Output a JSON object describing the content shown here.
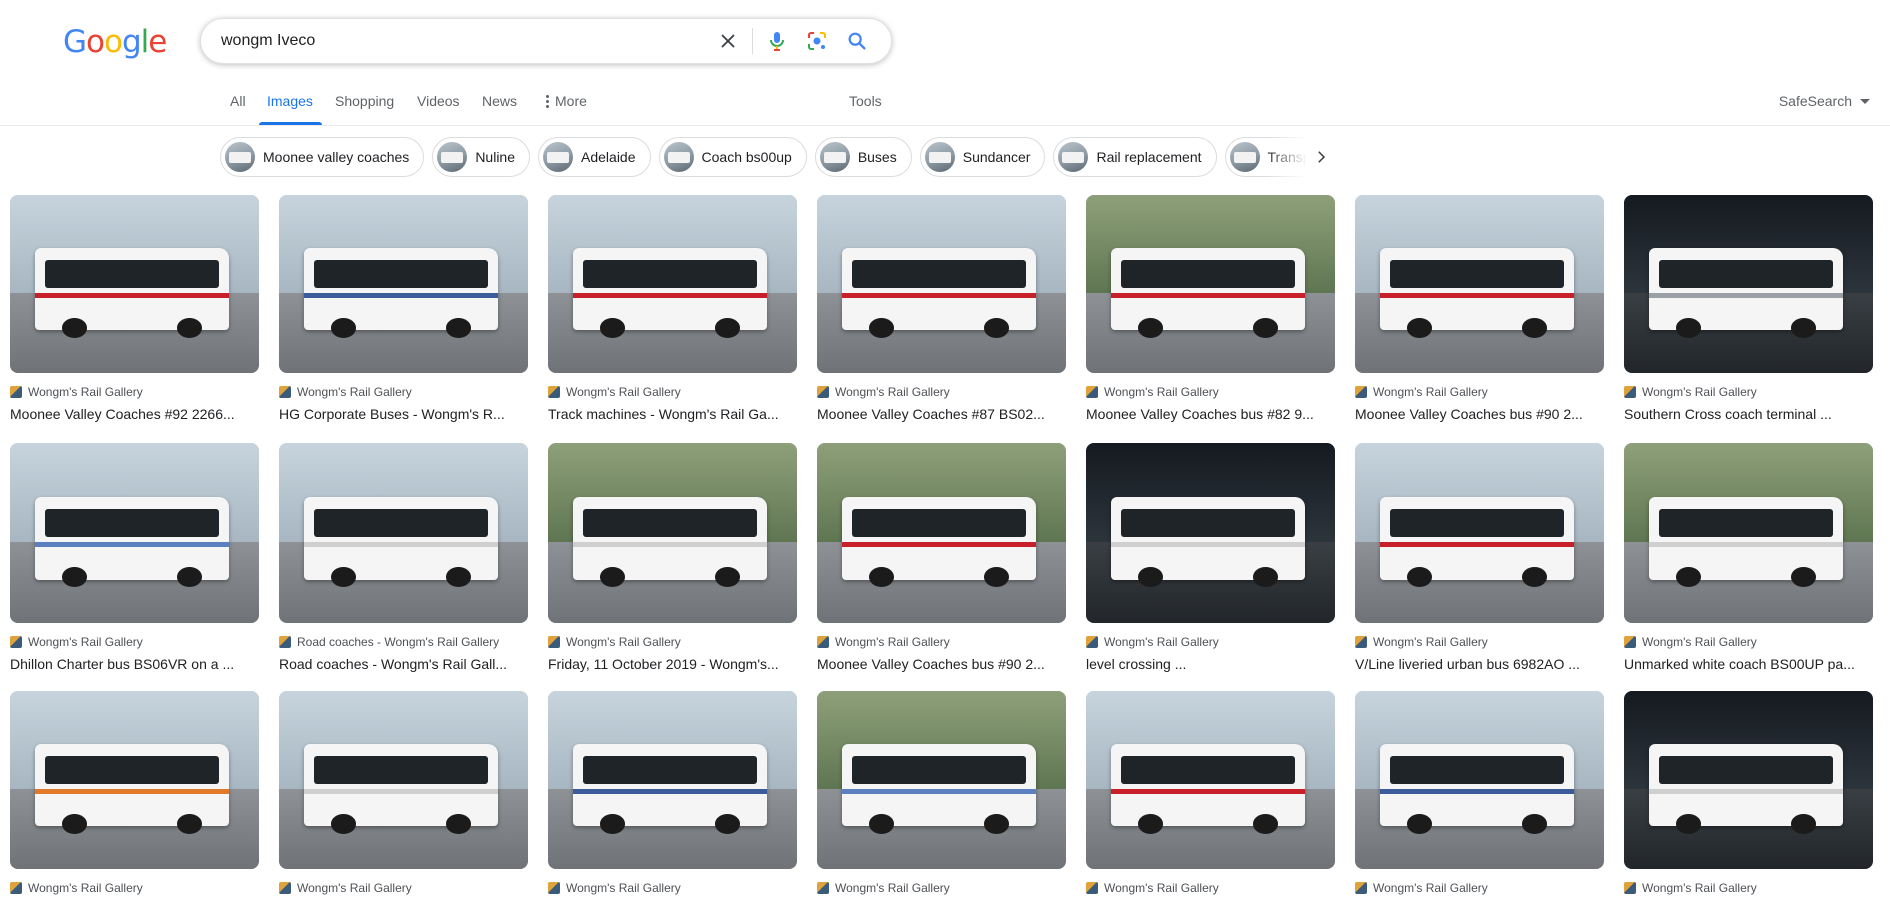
{
  "logo": {
    "text": "Google",
    "letters": [
      {
        "ch": "G",
        "color": "#4285F4"
      },
      {
        "ch": "o",
        "color": "#EA4335"
      },
      {
        "ch": "o",
        "color": "#FBBC05"
      },
      {
        "ch": "g",
        "color": "#4285F4"
      },
      {
        "ch": "l",
        "color": "#34A853"
      },
      {
        "ch": "e",
        "color": "#EA4335"
      }
    ]
  },
  "search": {
    "query": "wongm Iveco",
    "clear_icon": "close-icon",
    "voice_icon": "microphone-icon",
    "lens_icon": "lens-icon",
    "submit_icon": "search-icon"
  },
  "tabs": [
    {
      "label": "All",
      "active": false
    },
    {
      "label": "Images",
      "active": true
    },
    {
      "label": "Shopping",
      "active": false
    },
    {
      "label": "Videos",
      "active": false
    },
    {
      "label": "News",
      "active": false
    },
    {
      "label": "More",
      "active": false
    }
  ],
  "tools_label": "Tools",
  "safesearch_label": "SafeSearch",
  "colors": {
    "accent": "#1a73e8",
    "text": "#202124",
    "muted": "#5f6368"
  },
  "chips": [
    "Moonee valley coaches",
    "Nuline",
    "Adelaide",
    "Coach bs00up",
    "Buses",
    "Sundancer",
    "Rail replacement",
    "Transpo"
  ],
  "results": [
    {
      "source": "Wongm's Rail Gallery",
      "title": "Moonee Valley Coaches #92 2266..."
    },
    {
      "source": "Wongm's Rail Gallery",
      "title": "HG Corporate Buses - Wongm's R..."
    },
    {
      "source": "Wongm's Rail Gallery",
      "title": "Track machines - Wongm's Rail Ga..."
    },
    {
      "source": "Wongm's Rail Gallery",
      "title": "Moonee Valley Coaches #87 BS02..."
    },
    {
      "source": "Wongm's Rail Gallery",
      "title": "Moonee Valley Coaches bus #82 9..."
    },
    {
      "source": "Wongm's Rail Gallery",
      "title": "Moonee Valley Coaches bus #90 2..."
    },
    {
      "source": "Wongm's Rail Gallery",
      "title": "Southern Cross coach terminal ..."
    },
    {
      "source": "Wongm's Rail Gallery",
      "title": "Dhillon Charter bus BS06VR on a ..."
    },
    {
      "source": "Road coaches - Wongm's Rail Gallery",
      "title": "Road coaches - Wongm's Rail Gall..."
    },
    {
      "source": "Wongm's Rail Gallery",
      "title": "Friday, 11 October 2019 - Wongm's..."
    },
    {
      "source": "Wongm's Rail Gallery",
      "title": "Moonee Valley Coaches bus #90 2..."
    },
    {
      "source": "Wongm's Rail Gallery",
      "title": "level crossing ..."
    },
    {
      "source": "Wongm's Rail Gallery",
      "title": "V/Line liveried urban bus 6982AO ..."
    },
    {
      "source": "Wongm's Rail Gallery",
      "title": "Unmarked white coach BS00UP pa..."
    },
    {
      "source": "Wongm's Rail Gallery",
      "title": ""
    },
    {
      "source": "Wongm's Rail Gallery",
      "title": ""
    },
    {
      "source": "Wongm's Rail Gallery",
      "title": ""
    },
    {
      "source": "Wongm's Rail Gallery",
      "title": ""
    },
    {
      "source": "Wongm's Rail Gallery",
      "title": ""
    },
    {
      "source": "Wongm's Rail Gallery",
      "title": ""
    },
    {
      "source": "Wongm's Rail Gallery",
      "title": ""
    }
  ]
}
